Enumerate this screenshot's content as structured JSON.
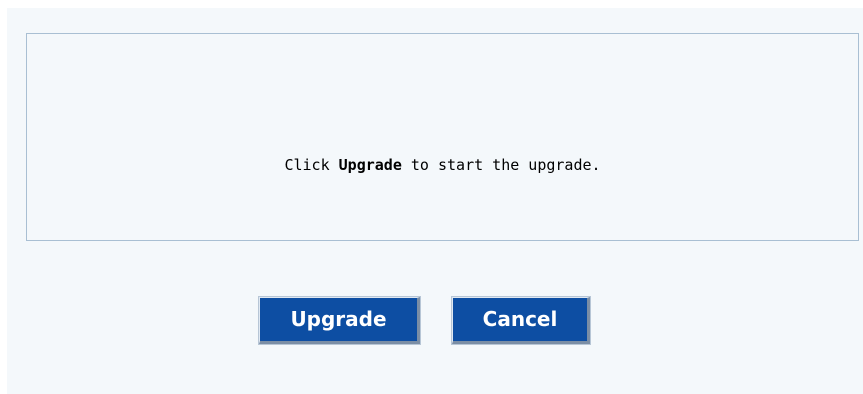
{
  "message": {
    "before": "Click ",
    "strong": "Upgrade",
    "after": " to start the upgrade."
  },
  "buttons": {
    "upgrade_label": "Upgrade",
    "cancel_label": "Cancel"
  },
  "colors": {
    "panel_background": "#f4f8fb",
    "box_border": "#a9bfd3",
    "button_background": "#0d4ea3",
    "button_text": "#ffffff"
  }
}
